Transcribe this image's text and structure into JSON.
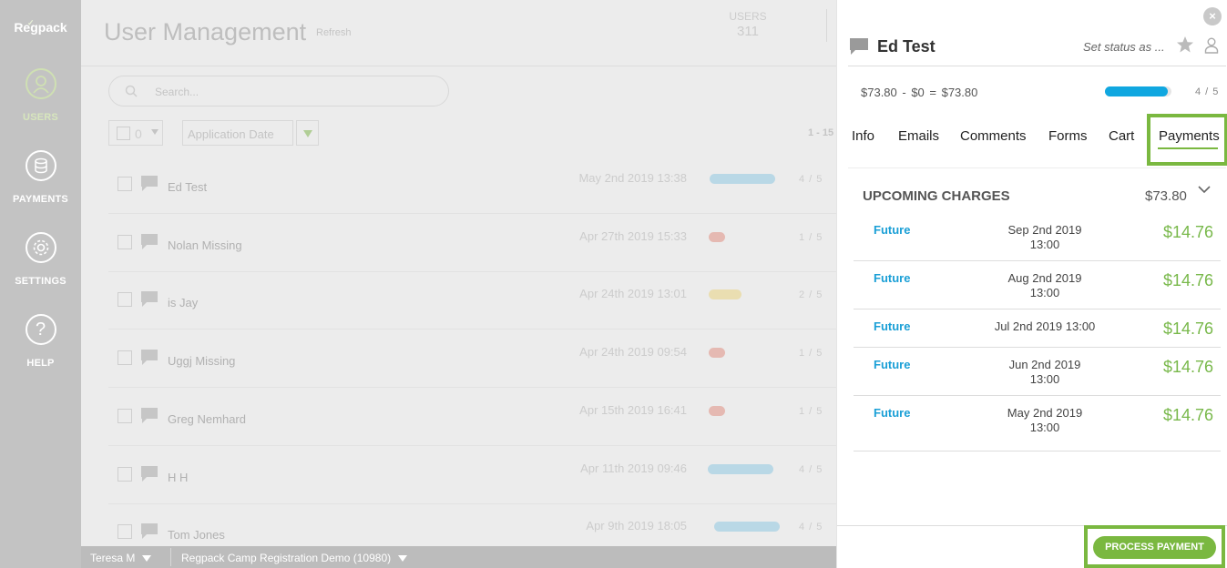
{
  "brand": {
    "logo": "Regpack"
  },
  "sidebar": {
    "items": [
      {
        "label": "USERS",
        "icon": "user-icon",
        "active": true
      },
      {
        "label": "PAYMENTS",
        "icon": "coins-icon",
        "active": false
      },
      {
        "label": "SETTINGS",
        "icon": "gear-icon",
        "active": false
      },
      {
        "label": "HELP",
        "icon": "question-icon",
        "active": false
      }
    ]
  },
  "header": {
    "title": "User Management",
    "refresh": "Refresh",
    "users_label": "USERS",
    "users_count": "311"
  },
  "search": {
    "placeholder": "Search..."
  },
  "toolbar": {
    "bulk_count": "0",
    "sort_field": "Application Date",
    "pager": "1 - 15"
  },
  "users": [
    {
      "name": "Ed Test",
      "date": "May 2nd 2019 13:38",
      "progress": "4 / 5",
      "status_color": "#a8dcf4"
    },
    {
      "name": "Nolan Missing",
      "date": "Apr 27th 2019 15:33",
      "progress": "1 / 5",
      "status_color": "#f3a89c"
    },
    {
      "name": "is Jay",
      "date": "Apr 24th 2019 13:01",
      "progress": "2 / 5",
      "status_color": "#fbe79a"
    },
    {
      "name": "Uggj Missing",
      "date": "Apr 24th 2019 09:54",
      "progress": "1 / 5",
      "status_color": "#f3a89c"
    },
    {
      "name": "Greg Nemhard",
      "date": "Apr 15th 2019 16:41",
      "progress": "1 / 5",
      "status_color": "#f3a89c"
    },
    {
      "name": "H H",
      "date": "Apr 11th 2019 09:46",
      "progress": "4 / 5",
      "status_color": "#a8dcf4"
    },
    {
      "name": "Tom Jones",
      "date": "Apr 9th 2019 18:05",
      "progress": "4 / 5",
      "status_color": "#a8dcf4"
    }
  ],
  "footer": {
    "user": "Teresa M",
    "org": "Regpack Camp Registration Demo (10980)"
  },
  "panel": {
    "close": "×",
    "name": "Ed Test",
    "set_status": "Set status as ...",
    "balance": "$73.80   -   $0   =   $73.80",
    "progress": "4 / 5",
    "progress_fraction": 0.95,
    "tabs": [
      "Info",
      "Emails",
      "Comments",
      "Forms",
      "Cart",
      "Payments"
    ],
    "active_tab": "Payments",
    "upcoming_title": "UPCOMING CHARGES",
    "upcoming_total": "$73.80",
    "charges": [
      {
        "type": "Future",
        "date_line1": "Sep 2nd 2019",
        "date_line2": "13:00",
        "amount": "$14.76"
      },
      {
        "type": "Future",
        "date_line1": "Aug 2nd 2019",
        "date_line2": "13:00",
        "amount": "$14.76"
      },
      {
        "type": "Future",
        "date_line1": "Jul 2nd 2019 13:00",
        "date_line2": "",
        "amount": "$14.76"
      },
      {
        "type": "Future",
        "date_line1": "Jun 2nd 2019",
        "date_line2": "13:00",
        "amount": "$14.76"
      },
      {
        "type": "Future",
        "date_line1": "May 2nd 2019",
        "date_line2": "13:00",
        "amount": "$14.76"
      }
    ],
    "process_button": "PROCESS PAYMENT"
  },
  "colors": {
    "accent_green": "#7ab840",
    "link_blue": "#1a9fd6",
    "progress_blue": "#10a7e0",
    "sidebar_gray": "#c3c3c3"
  }
}
